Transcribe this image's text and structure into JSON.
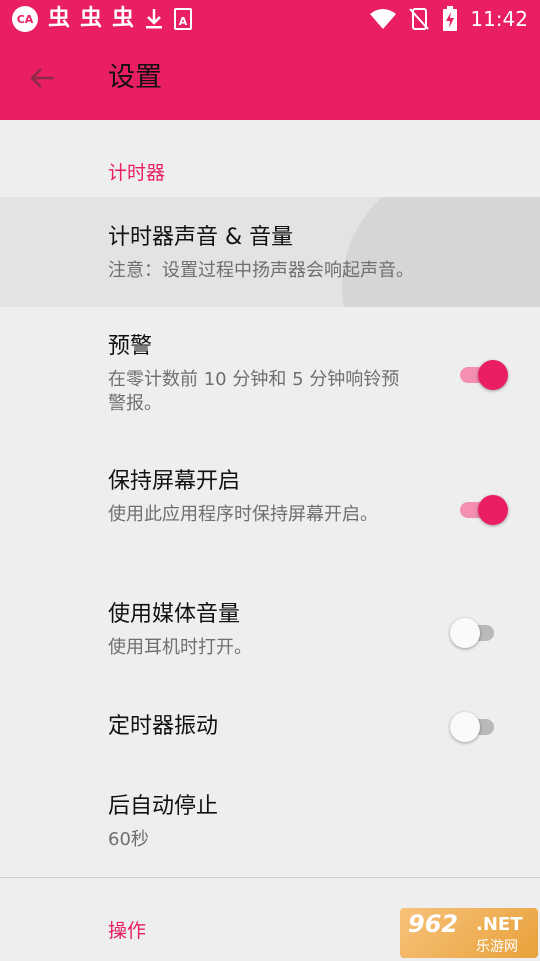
{
  "status_bar": {
    "time": "11:42",
    "app_icon_text": "CA",
    "notif_glyphs": [
      "虫",
      "虫",
      "虫"
    ],
    "download_icon": "download-icon",
    "a_icon": "A"
  },
  "app_bar": {
    "title": "设置",
    "back_icon": "arrow-left-icon"
  },
  "sections": {
    "timer_category": "计时器",
    "actions_category": "操作"
  },
  "prefs": {
    "sound": {
      "title": "计时器声音 & 音量",
      "summary": "注意：设置过程中扬声器会响起声音。"
    },
    "warning": {
      "title": "预警",
      "summary": "在零计数前 10 分钟和 5 分钟响铃预警报。",
      "enabled": true
    },
    "keep_screen": {
      "title": "保持屏幕开启",
      "summary": "使用此应用程序时保持屏幕开启。",
      "enabled": true
    },
    "media_volume": {
      "title": "使用媒体音量",
      "summary": "使用耳机时打开。",
      "enabled": false
    },
    "vibrate": {
      "title": "定时器振动",
      "enabled": false
    },
    "auto_stop": {
      "title": "后自动停止",
      "summary": "60秒"
    }
  },
  "watermark": {
    "number": "962",
    "net": ".NET",
    "cn": "乐游网"
  },
  "colors": {
    "accent": "#e91e63",
    "accent_light": "#f48fb1",
    "background": "#eeeeee"
  }
}
